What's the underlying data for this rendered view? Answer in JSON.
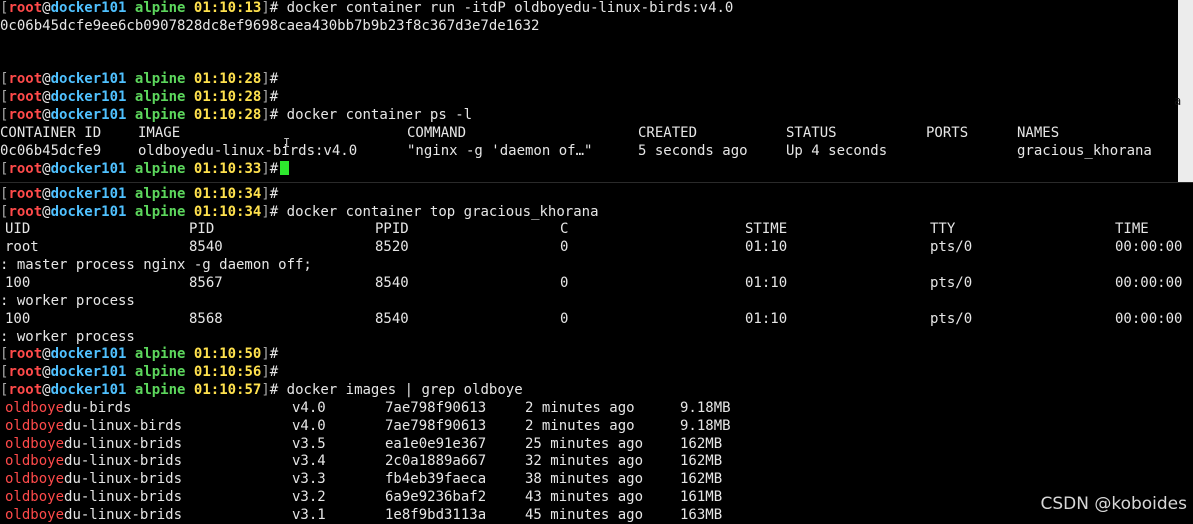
{
  "prompt": {
    "open": "[",
    "user": "root",
    "at": "@",
    "host": "docker101",
    "dir": "alpine",
    "close": "]",
    "sign": "#"
  },
  "top_pane": {
    "run_time": "01:10:13",
    "run_cmd": "docker container run -itdP oldboyedu-linux-birds:v4.0",
    "container_hash": "0c06b45dcfe9ee6cb0907828dc8ef9698caea430bb7b9b23f8c367d3e7de1632",
    "blank_time1": "01:10:28",
    "blank_time2": "01:10:28",
    "ps_time": "01:10:28",
    "ps_cmd": "docker container ps -l",
    "ps_headers": {
      "container_id": "CONTAINER ID",
      "image": "IMAGE",
      "command": "COMMAND",
      "created": "CREATED",
      "status": "STATUS",
      "ports": "PORTS",
      "names": "NAMES"
    },
    "ps_row": {
      "container_id": "0c06b45dcfe9",
      "image": "oldboyedu-linux-birds:v4.0",
      "command": "\"nginx -g 'daemon of…\"",
      "created": "5 seconds ago",
      "status": "Up 4 seconds",
      "ports": "",
      "names": "gracious_khorana"
    },
    "cursor_time": "01:10:33",
    "right_edge_glyph": "a"
  },
  "bottom_pane": {
    "blank_time1": "01:10:34",
    "top_time": "01:10:34",
    "top_cmd": "docker container top gracious_khorana",
    "top_headers": {
      "uid": "UID",
      "pid": "PID",
      "ppid": "PPID",
      "c": "C",
      "stime": "STIME",
      "tty": "TTY",
      "time": "TIME"
    },
    "processes": [
      {
        "uid": "root",
        "pid": "8540",
        "ppid": "8520",
        "c": "0",
        "stime": "01:10",
        "tty": "pts/0",
        "time": "00:00:00",
        "cmd": ": master process nginx -g daemon off;"
      },
      {
        "uid": "100",
        "pid": "8567",
        "ppid": "8540",
        "c": "0",
        "stime": "01:10",
        "tty": "pts/0",
        "time": "00:00:00",
        "cmd": ": worker process"
      },
      {
        "uid": "100",
        "pid": "8568",
        "ppid": "8540",
        "c": "0",
        "stime": "01:10",
        "tty": "pts/0",
        "time": "00:00:00",
        "cmd": ": worker process"
      }
    ],
    "blank_time2": "01:10:50",
    "blank_time3": "01:10:56",
    "images_time": "01:10:57",
    "images_cmd": "docker images | grep oldboye",
    "grep_match": "oldboye",
    "images": [
      {
        "rest": "du-birds",
        "tag": "v4.0",
        "id": "7ae798f90613",
        "created": "2 minutes ago",
        "size": "9.18MB"
      },
      {
        "rest": "du-linux-birds",
        "tag": "v4.0",
        "id": "7ae798f90613",
        "created": "2 minutes ago",
        "size": "9.18MB"
      },
      {
        "rest": "du-linux-brids",
        "tag": "v3.5",
        "id": "ea1e0e91e367",
        "created": "25 minutes ago",
        "size": "162MB"
      },
      {
        "rest": "du-linux-brids",
        "tag": "v3.4",
        "id": "2c0a1889a667",
        "created": "32 minutes ago",
        "size": "162MB"
      },
      {
        "rest": "du-linux-brids",
        "tag": "v3.3",
        "id": "fb4eb39faeca",
        "created": "38 minutes ago",
        "size": "162MB"
      },
      {
        "rest": "du-linux-brids",
        "tag": "v3.2",
        "id": "6a9e9236baf2",
        "created": "43 minutes ago",
        "size": "161MB"
      },
      {
        "rest": "du-linux-brids",
        "tag": "v3.1",
        "id": "1e8f9bd3113a",
        "created": "45 minutes ago",
        "size": "163MB"
      }
    ]
  },
  "watermark": "CSDN @koboides"
}
